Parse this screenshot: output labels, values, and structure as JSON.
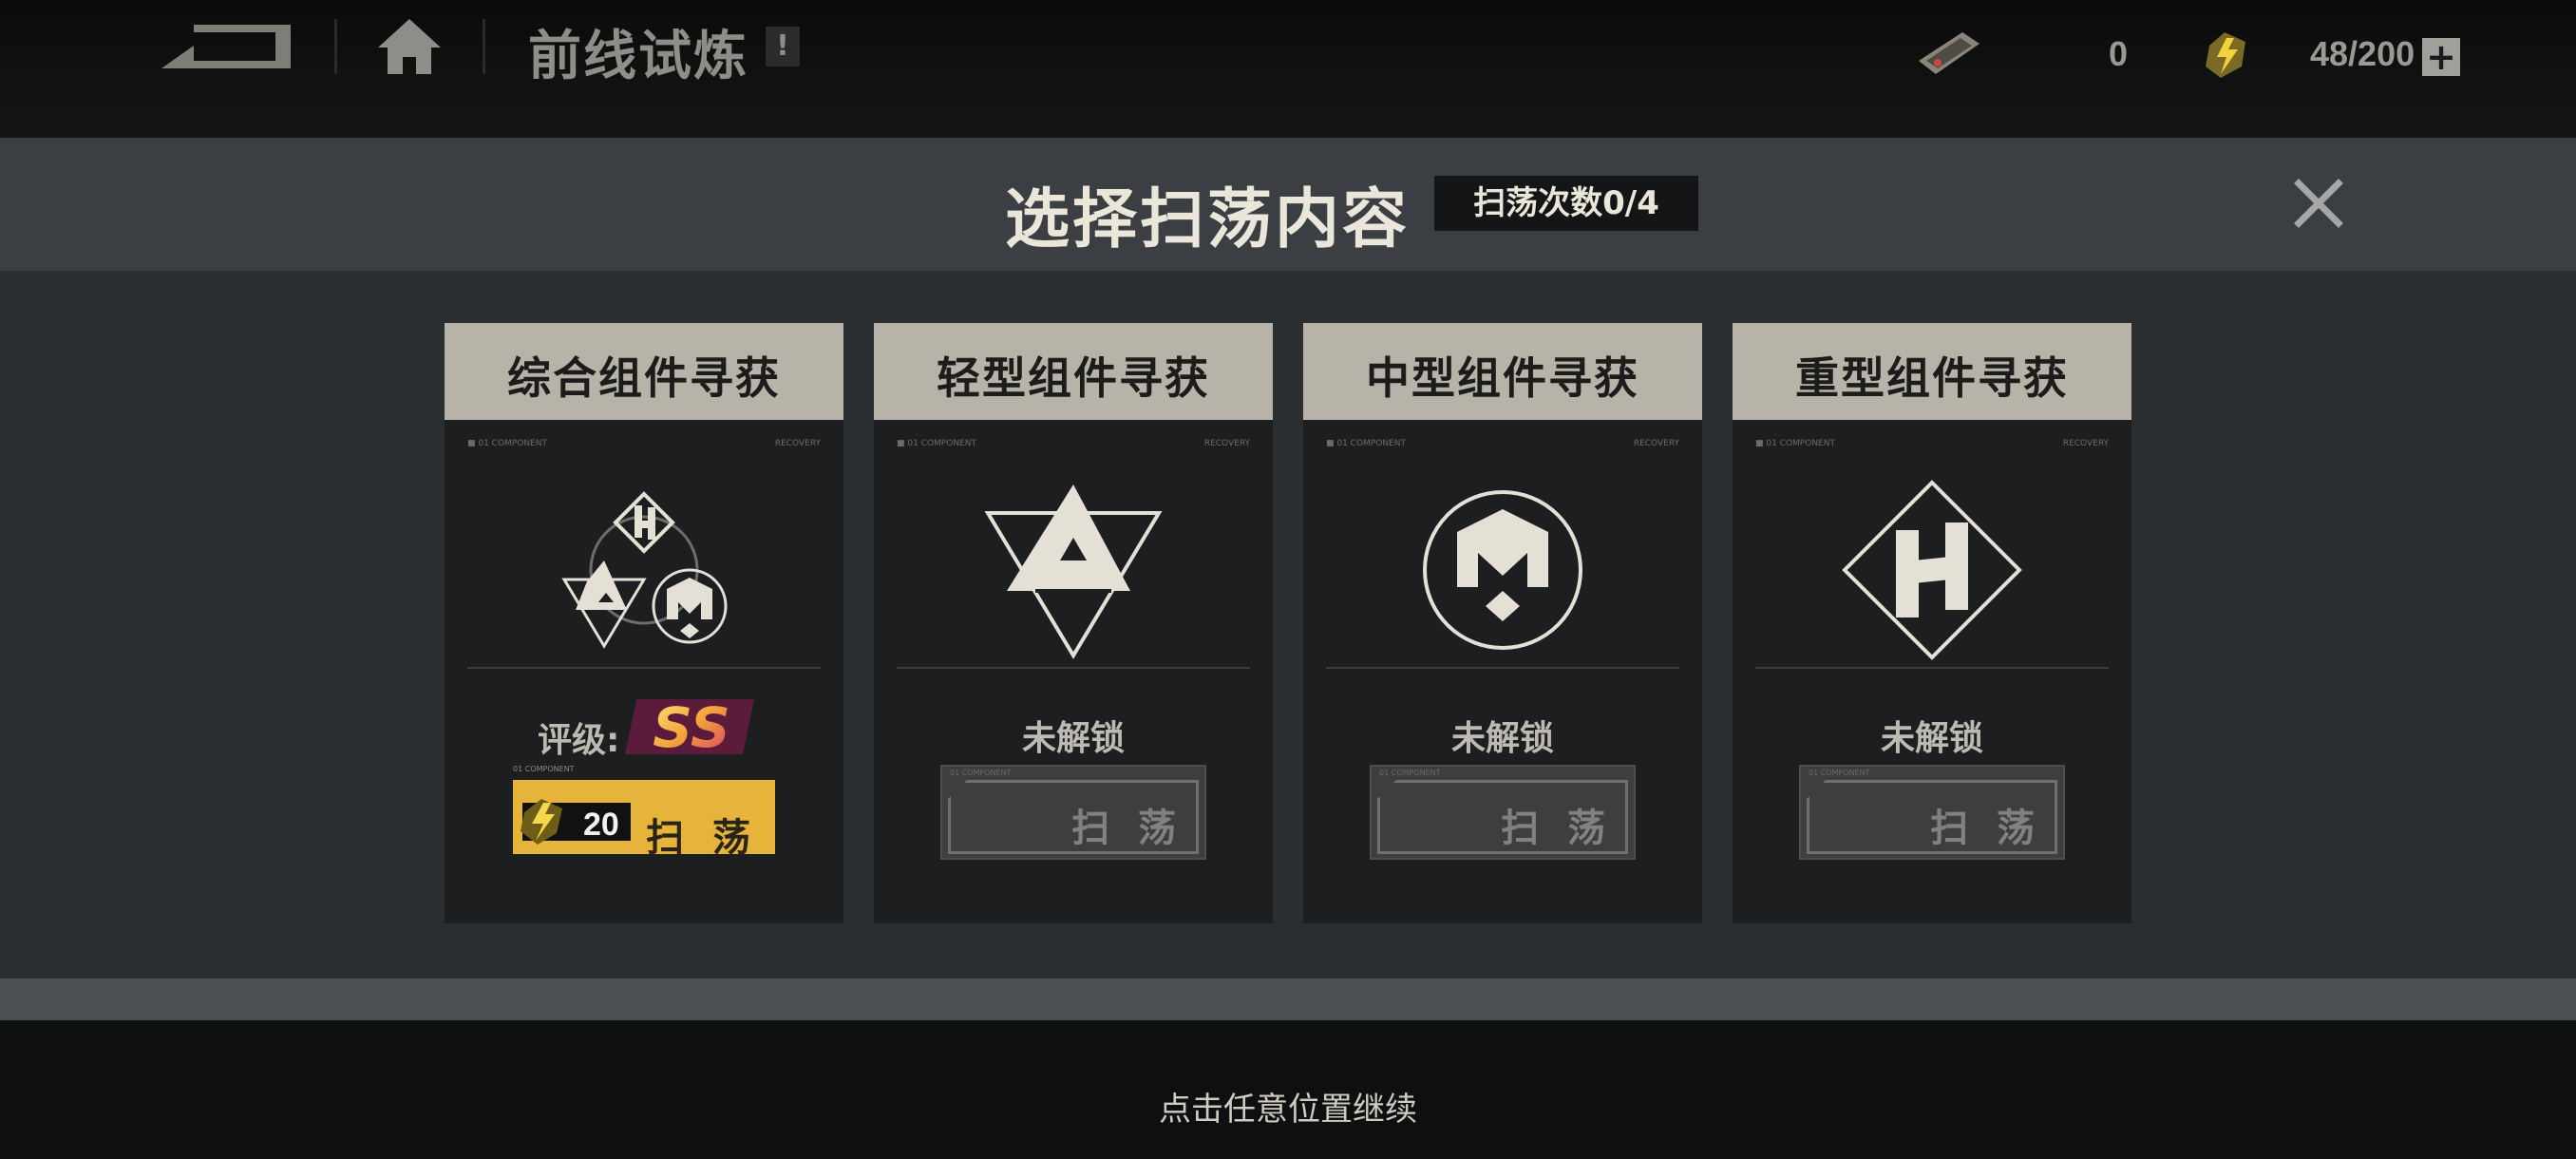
{
  "header": {
    "title": "前线试炼",
    "info_badge": "!",
    "resources": [
      {
        "icon": "ticket-icon",
        "value": "0"
      },
      {
        "icon": "energy-bolt-icon",
        "value": "48/200"
      }
    ],
    "add_label": "+"
  },
  "modal": {
    "title": "选择扫荡内容",
    "sweep_count": "扫荡次数0/4",
    "close_icon": "close-icon"
  },
  "cards": [
    {
      "title": "综合组件寻获",
      "emblem": "combined-emblem-icon",
      "status": "评级:",
      "grade": "SS",
      "cost": "20",
      "sweep_label": "扫 荡",
      "unlocked": true
    },
    {
      "title": "轻型组件寻获",
      "emblem": "light-emblem-icon",
      "status": "未解锁",
      "sweep_label": "扫 荡",
      "unlocked": false
    },
    {
      "title": "中型组件寻获",
      "emblem": "medium-emblem-icon",
      "status": "未解锁",
      "sweep_label": "扫 荡",
      "unlocked": false
    },
    {
      "title": "重型组件寻获",
      "emblem": "heavy-emblem-icon",
      "status": "未解锁",
      "sweep_label": "扫 荡",
      "unlocked": false
    }
  ],
  "continue_hint": "点击任意位置继续",
  "colors": {
    "accent_yellow": "#e6b43b",
    "card_header": "#b7b3a8",
    "modal_header": "#3b3e42",
    "modal_body": "#2b2e31"
  }
}
